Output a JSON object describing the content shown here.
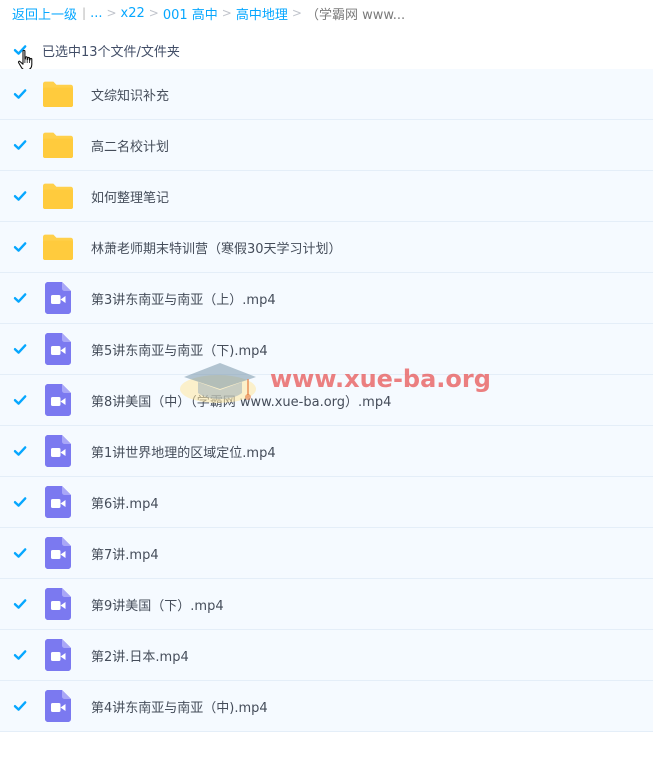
{
  "breadcrumb": {
    "back": "返回上一级",
    "ellipsis": "...",
    "sep": ">",
    "items": [
      "x22",
      "001 高中",
      "高中地理"
    ],
    "current": "（学霸网 www..."
  },
  "selection": {
    "text": "已选中13个文件/文件夹",
    "checked": true
  },
  "files": [
    {
      "name": "文综知识补充",
      "type": "folder"
    },
    {
      "name": "高二名校计划",
      "type": "folder"
    },
    {
      "name": "如何整理笔记",
      "type": "folder"
    },
    {
      "name": "林萧老师期末特训营（寒假30天学习计划）",
      "type": "folder"
    },
    {
      "name": "第3讲东南亚与南亚（上）.mp4",
      "type": "video"
    },
    {
      "name": "第5讲东南亚与南亚（下).mp4",
      "type": "video"
    },
    {
      "name": "第8讲美国（中）（学霸网 www.xue-ba.org）.mp4",
      "type": "video"
    },
    {
      "name": "第1讲世界地理的区域定位.mp4",
      "type": "video"
    },
    {
      "name": "第6讲.mp4",
      "type": "video"
    },
    {
      "name": "第7讲.mp4",
      "type": "video"
    },
    {
      "name": "第9讲美国（下）.mp4",
      "type": "video"
    },
    {
      "name": "第2讲.日本.mp4",
      "type": "video"
    },
    {
      "name": "第4讲东南亚与南亚（中).mp4",
      "type": "video"
    }
  ],
  "watermark": {
    "text": "www.xue-ba.org"
  },
  "colors": {
    "accent": "#06a7ff",
    "folder": "#ffd04b",
    "video": "#7b79f0",
    "row_bg": "#f5faff",
    "watermark": "#e85c5c"
  },
  "icons": {
    "checkbox": "checkbox-checked-icon",
    "folder": "folder-icon",
    "video": "video-file-icon",
    "cursor": "hand-pointer-icon"
  }
}
